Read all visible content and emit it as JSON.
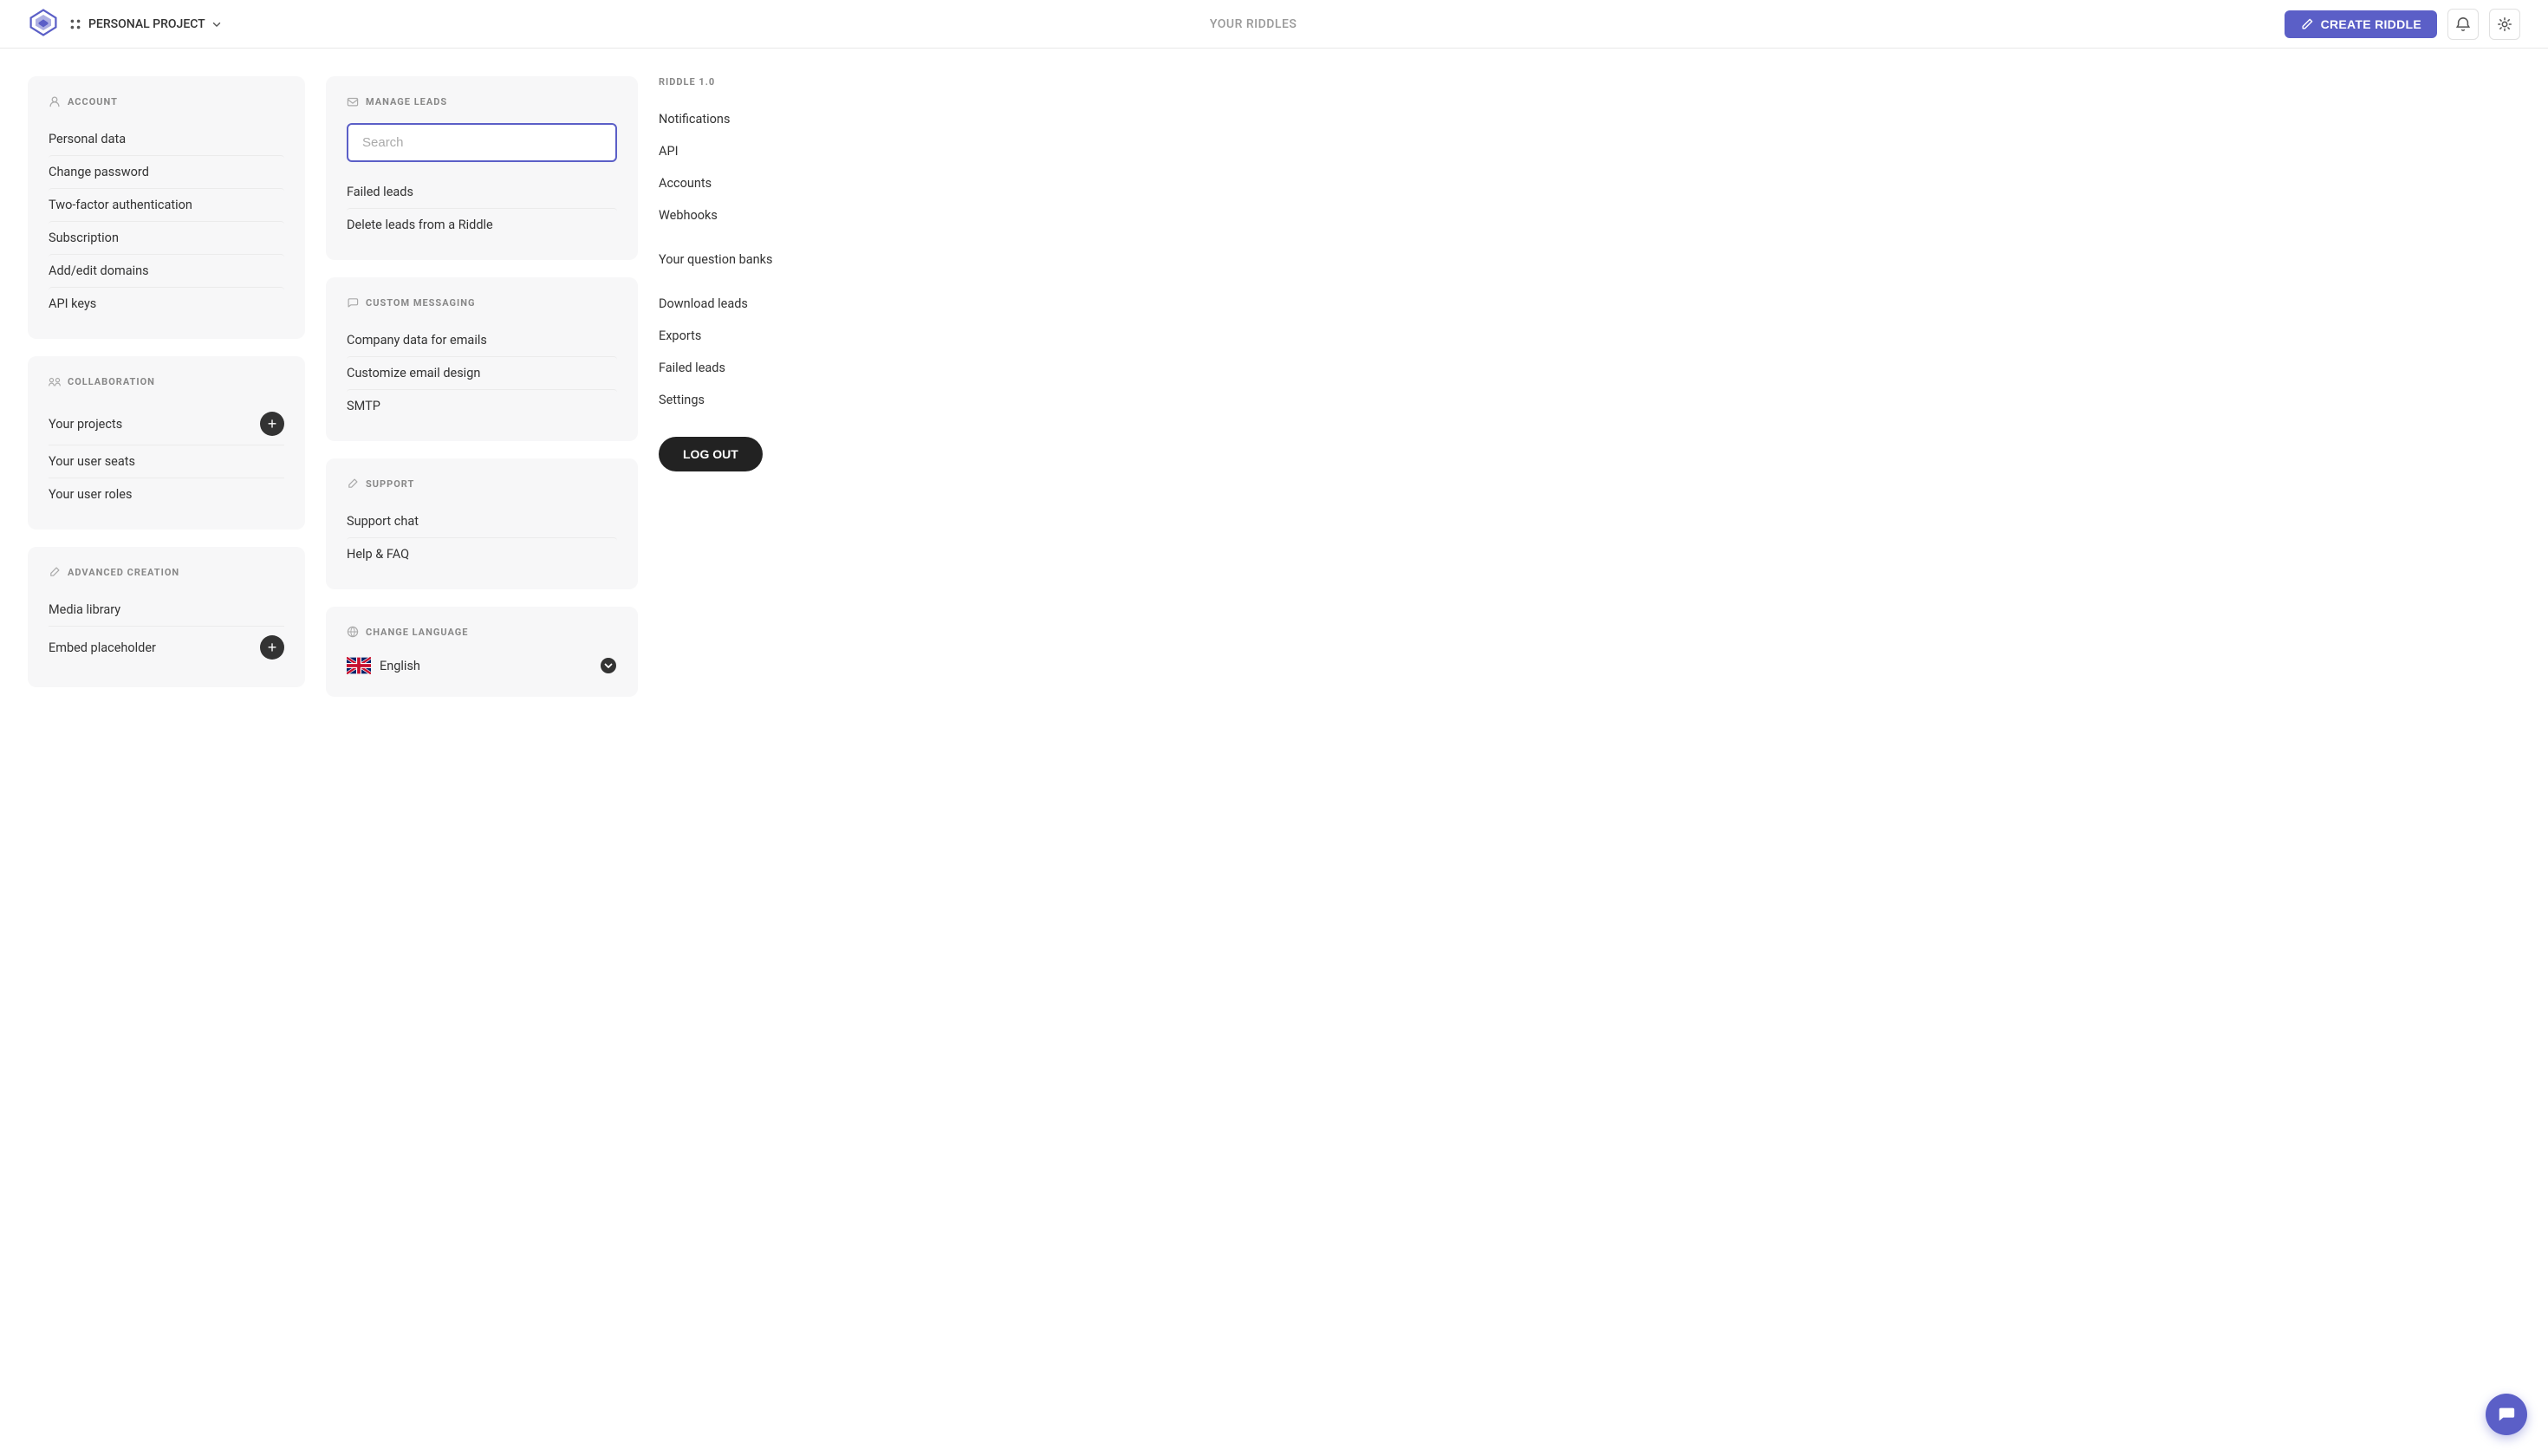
{
  "header": {
    "logo_alt": "Riddle Logo",
    "project_name": "PERSONAL PROJECT",
    "nav_center": "YOUR RIDDLES",
    "create_button": "CREATE RIDDLE",
    "notifications_label": "Notifications",
    "settings_label": "Settings"
  },
  "account_section": {
    "title": "ACCOUNT",
    "items": [
      {
        "label": "Personal data"
      },
      {
        "label": "Change password"
      },
      {
        "label": "Two-factor authentication"
      },
      {
        "label": "Subscription"
      },
      {
        "label": "Add/edit domains"
      },
      {
        "label": "API keys"
      }
    ]
  },
  "collaboration_section": {
    "title": "COLLABORATION",
    "items": [
      {
        "label": "Your projects",
        "has_add": true
      },
      {
        "label": "Your user seats",
        "has_add": false
      },
      {
        "label": "Your user roles",
        "has_add": false
      }
    ]
  },
  "advanced_creation_section": {
    "title": "ADVANCED CREATION",
    "items": [
      {
        "label": "Media library",
        "has_add": false
      },
      {
        "label": "Embed placeholder",
        "has_add": true
      }
    ]
  },
  "manage_leads_section": {
    "title": "MANAGE LEADS",
    "search_placeholder": "Search",
    "items": [
      {
        "label": "Failed leads"
      },
      {
        "label": "Delete leads from a Riddle"
      }
    ]
  },
  "custom_messaging_section": {
    "title": "CUSTOM MESSAGING",
    "items": [
      {
        "label": "Company data for emails"
      },
      {
        "label": "Customize email design"
      },
      {
        "label": "SMTP"
      }
    ]
  },
  "support_section": {
    "title": "SUPPORT",
    "items": [
      {
        "label": "Support chat"
      },
      {
        "label": "Help & FAQ"
      }
    ]
  },
  "change_language_section": {
    "title": "CHANGE LANGUAGE",
    "current_language": "English"
  },
  "riddle_section": {
    "title": "RIDDLE 1.0",
    "items": [
      {
        "label": "Notifications"
      },
      {
        "label": "API"
      },
      {
        "label": "Accounts"
      },
      {
        "label": "Webhooks"
      },
      {
        "label": "Your question banks"
      },
      {
        "label": "Download leads"
      },
      {
        "label": "Exports"
      },
      {
        "label": "Failed leads"
      },
      {
        "label": "Settings"
      }
    ],
    "logout_label": "LOG OUT"
  }
}
